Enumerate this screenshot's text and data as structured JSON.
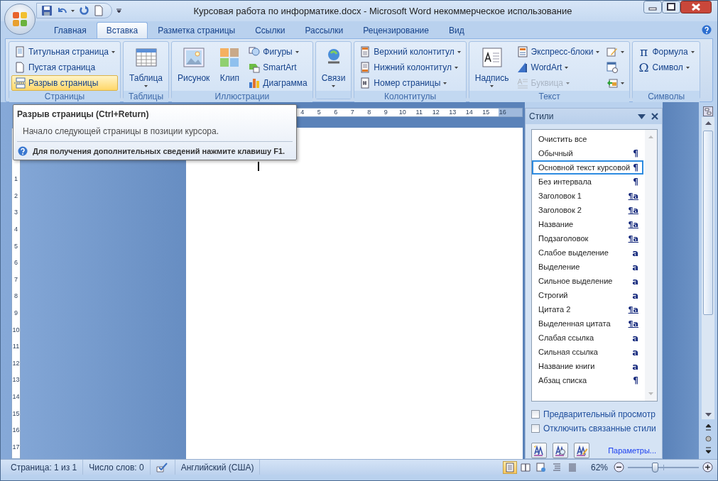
{
  "window": {
    "title": "Курсовая работа по информатике.docx - Microsoft Word некоммерческое использование"
  },
  "tabs": [
    {
      "label": "Главная",
      "selected": false
    },
    {
      "label": "Вставка",
      "selected": true
    },
    {
      "label": "Разметка страницы",
      "selected": false
    },
    {
      "label": "Ссылки",
      "selected": false
    },
    {
      "label": "Рассылки",
      "selected": false
    },
    {
      "label": "Рецензирование",
      "selected": false
    },
    {
      "label": "Вид",
      "selected": false
    }
  ],
  "ribbon": {
    "groups": [
      {
        "label": "Страницы",
        "items": [
          {
            "label": "Титульная страница",
            "kind": "small",
            "dropdown": true,
            "highlighted": false,
            "disabled": false
          },
          {
            "label": "Пустая страница",
            "kind": "small",
            "dropdown": false,
            "highlighted": false,
            "disabled": false
          },
          {
            "label": "Разрыв страницы",
            "kind": "small",
            "dropdown": false,
            "highlighted": true,
            "disabled": false
          }
        ]
      },
      {
        "label": "Таблицы",
        "items": [
          {
            "label": "Таблица",
            "kind": "large",
            "dropdown": true,
            "highlighted": false,
            "disabled": false
          }
        ]
      },
      {
        "label": "Иллюстрации",
        "items": [
          {
            "label": "Рисунок",
            "kind": "large",
            "dropdown": false,
            "highlighted": false,
            "disabled": false
          },
          {
            "label": "Клип",
            "kind": "large",
            "dropdown": false,
            "highlighted": false,
            "disabled": false
          },
          {
            "label": "Фигуры",
            "kind": "small",
            "dropdown": true,
            "highlighted": false,
            "disabled": false
          },
          {
            "label": "SmartArt",
            "kind": "small",
            "dropdown": false,
            "highlighted": false,
            "disabled": false
          },
          {
            "label": "Диаграмма",
            "kind": "small",
            "dropdown": false,
            "highlighted": false,
            "disabled": false
          }
        ]
      },
      {
        "items": [
          {
            "label": "Связи",
            "kind": "large",
            "dropdown": true,
            "highlighted": false,
            "disabled": false
          }
        ]
      },
      {
        "label": "Колонтитулы",
        "items": [
          {
            "label": "Верхний колонтитул",
            "kind": "small",
            "dropdown": true,
            "highlighted": false,
            "disabled": false
          },
          {
            "label": "Нижний колонтитул",
            "kind": "small",
            "dropdown": true,
            "highlighted": false,
            "disabled": false
          },
          {
            "label": "Номер страницы",
            "kind": "small",
            "dropdown": true,
            "highlighted": false,
            "disabled": false
          }
        ]
      },
      {
        "label": "Текст",
        "items": [
          {
            "label": "Надпись",
            "kind": "large",
            "dropdown": true,
            "highlighted": false,
            "disabled": false
          },
          {
            "label": "Экспресс-блоки",
            "kind": "small",
            "dropdown": true,
            "highlighted": false,
            "disabled": false
          },
          {
            "label": "WordArt",
            "kind": "small",
            "dropdown": true,
            "highlighted": false,
            "disabled": false
          },
          {
            "label": "Буквица",
            "kind": "small",
            "dropdown": true,
            "highlighted": false,
            "disabled": true
          },
          {
            "kind": "small",
            "dropdown": true,
            "highlighted": false,
            "disabled": false
          },
          {
            "kind": "small",
            "dropdown": false,
            "highlighted": false,
            "disabled": false
          },
          {
            "kind": "small",
            "dropdown": true,
            "highlighted": false,
            "disabled": false
          }
        ]
      },
      {
        "label": "Символы",
        "items": [
          {
            "label": "Формула",
            "glyph": "π",
            "kind": "small",
            "dropdown": true,
            "highlighted": false,
            "disabled": false
          },
          {
            "label": "Символ",
            "glyph": "Ω",
            "kind": "small",
            "dropdown": true,
            "highlighted": false,
            "disabled": false
          }
        ]
      }
    ]
  },
  "tooltip": {
    "title": "Разрыв страницы (Ctrl+Return)",
    "description": "Начало следующей страницы в позиции курсора.",
    "help": "Для получения дополнительных сведений нажмите клавишу F1."
  },
  "ruler": {
    "horizontal": [
      "4",
      "5",
      "6",
      "7",
      "8",
      "9",
      "10",
      "11",
      "12",
      "13",
      "14",
      "15",
      "16"
    ],
    "vertical": [
      "1",
      "2",
      "3",
      "4",
      "5",
      "6",
      "7",
      "8",
      "9",
      "10",
      "11",
      "12",
      "13",
      "14",
      "15",
      "16",
      "17"
    ]
  },
  "styles_pane": {
    "title": "Стили",
    "styles": [
      {
        "name": "Очистить все",
        "selected": false
      },
      {
        "name": "Обычный",
        "mark": "¶",
        "kind": "paragraph",
        "selected": false
      },
      {
        "name": "Основной текст курсовой",
        "mark": "¶",
        "kind": "paragraph",
        "selected": true
      },
      {
        "name": "Без интервала",
        "mark": "¶",
        "kind": "paragraph",
        "selected": false
      },
      {
        "name": "Заголовок 1",
        "mark": "¶a",
        "kind": "linked",
        "selected": false
      },
      {
        "name": "Заголовок 2",
        "mark": "¶a",
        "kind": "linked",
        "selected": false
      },
      {
        "name": "Название",
        "mark": "¶a",
        "kind": "linked",
        "selected": false
      },
      {
        "name": "Подзаголовок",
        "mark": "¶a",
        "kind": "linked",
        "selected": false
      },
      {
        "name": "Слабое выделение",
        "mark": "a",
        "kind": "character",
        "selected": false
      },
      {
        "name": "Выделение",
        "mark": "a",
        "kind": "character",
        "selected": false
      },
      {
        "name": "Сильное выделение",
        "mark": "a",
        "kind": "character",
        "selected": false
      },
      {
        "name": "Строгий",
        "mark": "a",
        "kind": "character",
        "selected": false
      },
      {
        "name": "Цитата 2",
        "mark": "¶a",
        "kind": "linked",
        "selected": false
      },
      {
        "name": "Выделенная цитата",
        "mark": "¶a",
        "kind": "linked",
        "selected": false
      },
      {
        "name": "Слабая ссылка",
        "mark": "a",
        "kind": "character",
        "selected": false
      },
      {
        "name": "Сильная ссылка",
        "mark": "a",
        "kind": "character",
        "selected": false
      },
      {
        "name": "Название книги",
        "mark": "a",
        "kind": "character",
        "selected": false
      },
      {
        "name": "Абзац списка",
        "mark": "¶",
        "kind": "paragraph",
        "selected": false
      }
    ],
    "options": [
      {
        "label": "Предварительный просмотр",
        "checked": false
      },
      {
        "label": "Отключить связанные стили",
        "checked": false
      }
    ],
    "link": "Параметры..."
  },
  "status_bar": {
    "page": "Страница: 1 из 1",
    "words": "Число слов: 0",
    "language": "Английский (США)",
    "views": [
      {
        "selected": true
      },
      {
        "selected": false
      },
      {
        "selected": false
      },
      {
        "selected": false
      },
      {
        "selected": false
      }
    ],
    "zoom": "62%",
    "zoom_level": {
      "level": 0.38
    }
  }
}
